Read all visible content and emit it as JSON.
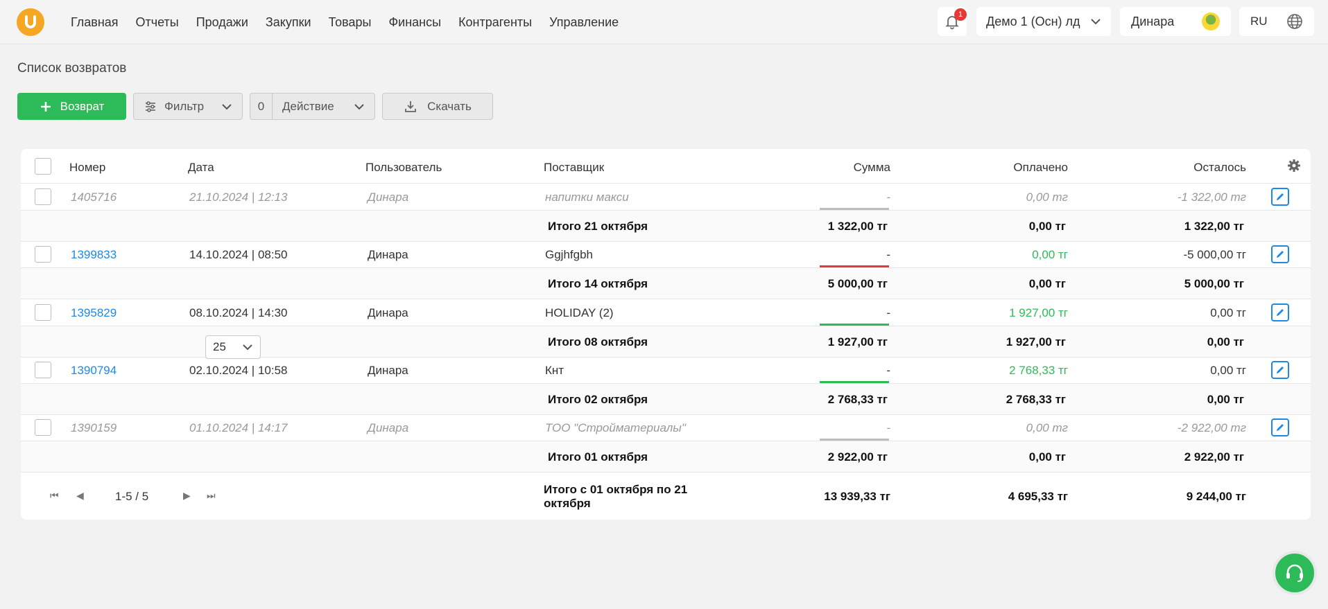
{
  "header": {
    "nav": [
      "Главная",
      "Отчеты",
      "Продажи",
      "Закупки",
      "Товары",
      "Финансы",
      "Контрагенты",
      "Управление"
    ],
    "notif_count": "1",
    "org": "Демо 1 (Осн) лд",
    "user": "Динара",
    "lang": "RU"
  },
  "page": {
    "title": "Список возвратов"
  },
  "toolbar": {
    "add_label": "Возврат",
    "filter_label": "Фильтр",
    "action_count": "0",
    "action_label": "Действие",
    "download_label": "Скачать"
  },
  "table": {
    "columns": [
      "Номер",
      "Дата",
      "Пользователь",
      "Поставщик",
      "Сумма",
      "Оплачено",
      "Осталось"
    ],
    "rows": [
      {
        "number": "1405716",
        "date": "21.10.2024 | 12:13",
        "user": "Динара",
        "supplier": "напитки макси",
        "sum": "-",
        "paid": "0,00 тг",
        "left": "-1 322,00 тг",
        "style": "muted",
        "bar": "#bdbdbd",
        "subtotal": {
          "label": "Итого 21 октября",
          "sum": "1 322,00 тг",
          "paid": "0,00 тг",
          "left": "1 322,00 тг"
        }
      },
      {
        "number": "1399833",
        "date": "14.10.2024 | 08:50",
        "user": "Динара",
        "supplier": "Ggjhfgbh",
        "sum": "-",
        "paid": "0,00 тг",
        "left": "-5 000,00 тг",
        "style": "normal",
        "bar": "#e53935",
        "subtotal": {
          "label": "Итого 14 октября",
          "sum": "5 000,00 тг",
          "paid": "0,00 тг",
          "left": "5 000,00 тг"
        }
      },
      {
        "number": "1395829",
        "date": "08.10.2024 | 14:30",
        "user": "Динара",
        "supplier": "HOLIDAY (2)",
        "sum": "-",
        "paid": "1 927,00 тг",
        "left": "0,00 тг",
        "style": "normal",
        "bar": "#2dbb5a",
        "subtotal": {
          "label": "Итого 08 октября",
          "sum": "1 927,00 тг",
          "paid": "1 927,00 тг",
          "left": "0,00 тг"
        }
      },
      {
        "number": "1390794",
        "date": "02.10.2024 | 10:58",
        "user": "Динара",
        "supplier": "Кнт",
        "sum": "-",
        "paid": "2 768,33 тг",
        "left": "0,00 тг",
        "style": "normal",
        "bar": "#2dbb5a",
        "subtotal": {
          "label": "Итого 02 октября",
          "sum": "2 768,33 тг",
          "paid": "2 768,33 тг",
          "left": "0,00 тг"
        }
      },
      {
        "number": "1390159",
        "date": "01.10.2024 | 14:17",
        "user": "Динара",
        "supplier": "ТОО \"Стройматериалы\"",
        "sum": "-",
        "paid": "0,00 тг",
        "left": "-2 922,00 тг",
        "style": "muted",
        "bar": "#bdbdbd",
        "subtotal": {
          "label": "Итого 01 октября",
          "sum": "2 922,00 тг",
          "paid": "0,00 тг",
          "left": "2 922,00 тг"
        }
      }
    ]
  },
  "footer": {
    "range": "1-5 / 5",
    "page_size": "25",
    "total_label": "Итого с 01 октября по 21 октября",
    "total_sum": "13 939,33 тг",
    "total_paid": "4 695,33 тг",
    "total_left": "9 244,00 тг"
  }
}
